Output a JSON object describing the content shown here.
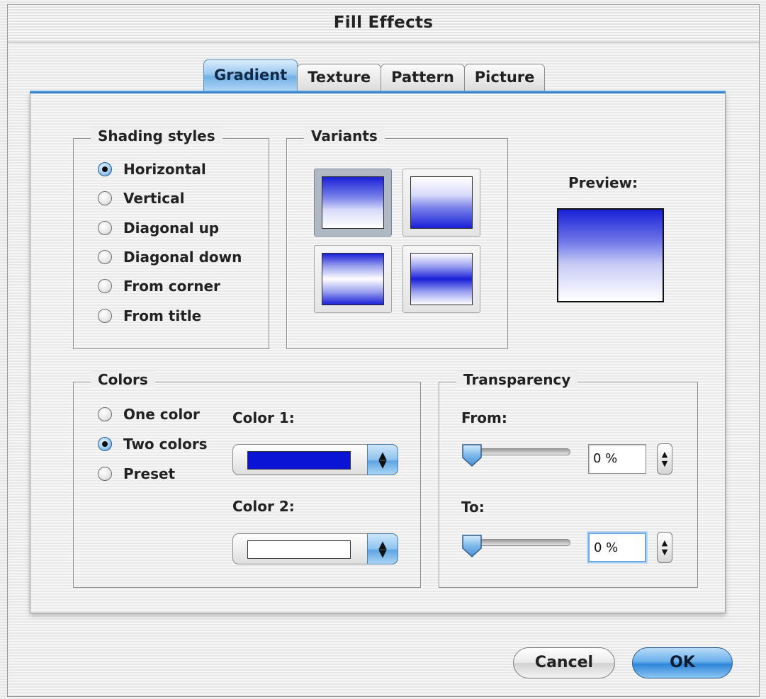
{
  "window": {
    "title": "Fill Effects"
  },
  "tabs": [
    {
      "label": "Gradient",
      "active": true
    },
    {
      "label": "Texture",
      "active": false
    },
    {
      "label": "Pattern",
      "active": false
    },
    {
      "label": "Picture",
      "active": false
    }
  ],
  "shading": {
    "label": "Shading styles",
    "options": [
      "Horizontal",
      "Vertical",
      "Diagonal up",
      "Diagonal down",
      "From corner",
      "From title"
    ],
    "selected": "Horizontal"
  },
  "variants": {
    "label": "Variants",
    "selected_index": 0
  },
  "preview": {
    "label": "Preview:"
  },
  "colors": {
    "label": "Colors",
    "options": [
      "One color",
      "Two colors",
      "Preset"
    ],
    "selected": "Two colors",
    "color1_label": "Color 1:",
    "color1_value": "#0a14d4",
    "color2_label": "Color 2:",
    "color2_value": "#ffffff"
  },
  "transparency": {
    "label": "Transparency",
    "from_label": "From:",
    "from_value": "0 %",
    "to_label": "To:",
    "to_value": "0 %",
    "from_level": 0,
    "to_level": 0
  },
  "buttons": {
    "cancel": "Cancel",
    "ok": "OK"
  },
  "accent_color": "#3a8ee0"
}
